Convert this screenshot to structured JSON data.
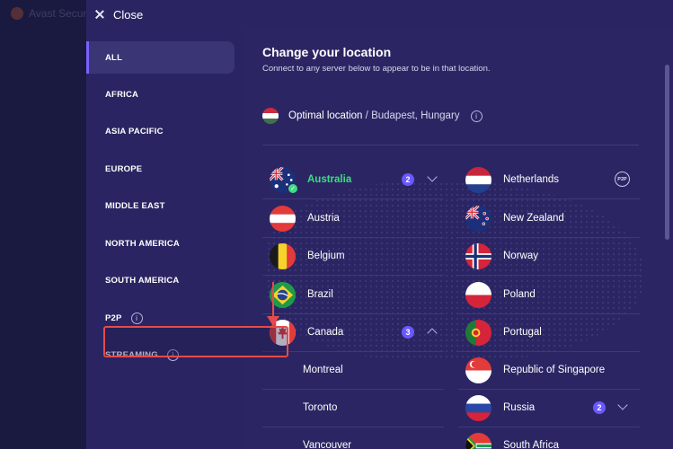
{
  "background_app": {
    "title": "Avast Secure"
  },
  "topbar": {
    "close_label": "Close"
  },
  "sidebar": {
    "items": [
      {
        "label": "ALL",
        "active": true
      },
      {
        "label": "AFRICA"
      },
      {
        "label": "ASIA PACIFIC"
      },
      {
        "label": "EUROPE"
      },
      {
        "label": "MIDDLE EAST"
      },
      {
        "label": "NORTH AMERICA"
      },
      {
        "label": "SOUTH AMERICA"
      },
      {
        "label": "P2P",
        "info": true
      },
      {
        "label": "STREAMING",
        "info": true
      }
    ],
    "info_glyph": "i"
  },
  "main": {
    "title": "Change your location",
    "subtitle": "Connect to any server below to appear to be in that location.",
    "optimal": {
      "label": "Optimal location",
      "separator": "/",
      "location": "Budapest, Hungary",
      "info_glyph": "i"
    },
    "left_column": [
      {
        "name": "Australia",
        "flag": "australia",
        "selected": true,
        "badge": "2",
        "expanded": false,
        "highlight_color": "#3ddc84"
      },
      {
        "name": "Austria",
        "flag": "austria"
      },
      {
        "name": "Belgium",
        "flag": "belgium"
      },
      {
        "name": "Brazil",
        "flag": "brazil"
      },
      {
        "name": "Canada",
        "flag": "canada",
        "badge": "3",
        "expanded": true,
        "cities": [
          "Montreal",
          "Toronto",
          "Vancouver"
        ]
      }
    ],
    "right_column": [
      {
        "name": "Netherlands",
        "flag": "netherlands",
        "tag": "P2P"
      },
      {
        "name": "New Zealand",
        "flag": "new-zealand"
      },
      {
        "name": "Norway",
        "flag": "norway"
      },
      {
        "name": "Poland",
        "flag": "poland"
      },
      {
        "name": "Portugal",
        "flag": "portugal"
      },
      {
        "name": "Republic of Singapore",
        "flag": "singapore"
      },
      {
        "name": "Russia",
        "flag": "russia",
        "badge": "2",
        "expanded": false
      },
      {
        "name": "South Africa",
        "flag": "south-africa"
      }
    ]
  },
  "colors": {
    "accent": "#6a58ff",
    "annotation": "#e84a4a",
    "connected": "#3ddc84",
    "panel": "#2a2562"
  }
}
